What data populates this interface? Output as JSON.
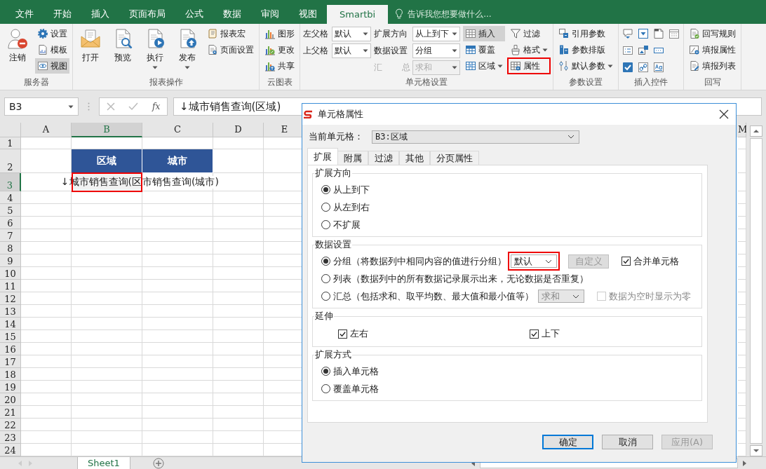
{
  "ribbon_tabs": [
    {
      "label": "文件",
      "selected": false
    },
    {
      "label": "开始",
      "selected": false
    },
    {
      "label": "插入",
      "selected": false
    },
    {
      "label": "页面布局",
      "selected": false
    },
    {
      "label": "公式",
      "selected": false
    },
    {
      "label": "数据",
      "selected": false
    },
    {
      "label": "审阅",
      "selected": false
    },
    {
      "label": "视图",
      "selected": false
    },
    {
      "label": "Smartbi",
      "selected": true
    }
  ],
  "tell_me": {
    "placeholder": "告诉我您想要做什么..."
  },
  "ribbon_groups": [
    {
      "label": "服务器",
      "columns": [
        [
          {
            "kind": "large",
            "label": "注销"
          }
        ],
        [
          {
            "kind": "small",
            "label": "设置"
          },
          {
            "kind": "small",
            "label": "模板"
          },
          {
            "kind": "small",
            "label": "视图",
            "pressed": true
          }
        ]
      ]
    },
    {
      "label": "报表操作",
      "columns": [
        [
          {
            "kind": "large",
            "label": "打开"
          }
        ],
        [
          {
            "kind": "large",
            "label": "预览"
          }
        ],
        [
          {
            "kind": "large",
            "label": "执行",
            "dropdown": true
          }
        ],
        [
          {
            "kind": "large",
            "label": "发布",
            "dropdown": true
          }
        ],
        [
          {
            "kind": "small",
            "label": "报表宏"
          },
          {
            "kind": "small",
            "label": "页面设置"
          }
        ]
      ]
    },
    {
      "label": "云图表",
      "columns": [
        [
          {
            "kind": "small",
            "label": "图形"
          },
          {
            "kind": "small",
            "label": "更改"
          },
          {
            "kind": "small",
            "label": "共享"
          }
        ]
      ]
    },
    {
      "label": "单元格设置",
      "columns": [
        [
          {
            "kind": "field",
            "label": "左父格",
            "value": "默认"
          },
          {
            "kind": "field",
            "label": "上父格",
            "value": "默认"
          }
        ],
        [
          {
            "kind": "field",
            "label": "扩展方向",
            "value": "从上到下"
          },
          {
            "kind": "field",
            "label": "数据设置",
            "value": "分组"
          },
          {
            "kind": "field",
            "label": "汇 总",
            "value": "求和",
            "disabled": true
          }
        ],
        [
          {
            "kind": "small",
            "label": "插入",
            "pressed": true
          },
          {
            "kind": "small",
            "label": "覆盖"
          },
          {
            "kind": "small",
            "label": "区域",
            "dropdown": true
          }
        ],
        [
          {
            "kind": "small",
            "label": "过滤"
          },
          {
            "kind": "small",
            "label": "格式",
            "dropdown": true
          },
          {
            "kind": "small",
            "label": "属性",
            "annotated": true
          }
        ]
      ]
    },
    {
      "label": "参数设置",
      "columns": [
        [
          {
            "kind": "small",
            "label": "引用参数"
          },
          {
            "kind": "small",
            "label": "参数排版"
          },
          {
            "kind": "small",
            "label": "默认参数",
            "dropdown": true
          }
        ]
      ]
    },
    {
      "label": "插入控件",
      "columns": [
        [
          {
            "kind": "icon"
          },
          {
            "kind": "icon"
          },
          {
            "kind": "icon"
          }
        ],
        [
          {
            "kind": "icon"
          },
          {
            "kind": "icon"
          },
          {
            "kind": "icon"
          }
        ],
        [
          {
            "kind": "icon"
          },
          {
            "kind": "icon"
          },
          {
            "kind": "icon"
          }
        ],
        [
          {
            "kind": "icon"
          }
        ]
      ]
    },
    {
      "label": "回写",
      "columns": [
        [
          {
            "kind": "small",
            "label": "回写规则"
          },
          {
            "kind": "small",
            "label": "填报属性"
          },
          {
            "kind": "small",
            "label": "填报列表"
          }
        ]
      ]
    }
  ],
  "formula_bar": {
    "name_box": "B3",
    "function_label": "fx",
    "formula": "↓城市销售查询(区域)"
  },
  "sheet": {
    "columns": [
      {
        "label": "A",
        "selected": false
      },
      {
        "label": "B",
        "selected": true
      },
      {
        "label": "C",
        "selected": false
      },
      {
        "label": "D",
        "selected": false
      },
      {
        "label": "E",
        "selected": false
      },
      {
        "label": "M",
        "selected": false
      }
    ],
    "rows": [
      {
        "label": "1",
        "selected": false
      },
      {
        "label": "2",
        "selected": false,
        "cells": {
          "B": {
            "text": "区域",
            "kind": "header"
          },
          "C": {
            "text": "城市",
            "kind": "header"
          }
        }
      },
      {
        "label": "3",
        "selected": true,
        "cells": {
          "B": {
            "text": "↓城市销售查询(区",
            "kind": "value",
            "selected": true,
            "annotated": true,
            "overflows_left": true
          },
          "C": {
            "text": "市销售查询(城市)",
            "kind": "value"
          }
        }
      },
      {
        "label": "4",
        "selected": false
      },
      {
        "label": "5",
        "selected": false
      },
      {
        "label": "6",
        "selected": false
      },
      {
        "label": "7",
        "selected": false
      },
      {
        "label": "8",
        "selected": false
      },
      {
        "label": "9",
        "selected": false
      },
      {
        "label": "10",
        "selected": false
      },
      {
        "label": "11",
        "selected": false
      },
      {
        "label": "12",
        "selected": false
      },
      {
        "label": "13",
        "selected": false
      },
      {
        "label": "14",
        "selected": false
      },
      {
        "label": "15",
        "selected": false
      },
      {
        "label": "16",
        "selected": false
      },
      {
        "label": "17",
        "selected": false
      },
      {
        "label": "18",
        "selected": false
      },
      {
        "label": "19",
        "selected": false
      },
      {
        "label": "20",
        "selected": false
      },
      {
        "label": "21",
        "selected": false
      },
      {
        "label": "22",
        "selected": false
      },
      {
        "label": "23",
        "selected": false
      },
      {
        "label": "24",
        "selected": false
      }
    ],
    "tabs": [
      {
        "label": "Sheet1",
        "selected": true
      }
    ]
  },
  "dialog": {
    "title": "单元格属性",
    "current_cell": {
      "label": "当前单元格：",
      "value": "B3:区域"
    },
    "tabs": [
      {
        "label": "扩展",
        "selected": true
      },
      {
        "label": "附属",
        "selected": false
      },
      {
        "label": "过滤",
        "selected": false
      },
      {
        "label": "其他",
        "selected": false
      },
      {
        "label": "分页属性",
        "selected": false
      }
    ],
    "sections": [
      {
        "title": "扩展方向",
        "kind": "radios",
        "options": [
          {
            "label": "从上到下",
            "selected": true
          },
          {
            "label": "从左到右",
            "selected": false
          },
          {
            "label": "不扩展",
            "selected": false
          }
        ]
      },
      {
        "title": "数据设置",
        "kind": "radios",
        "options": [
          {
            "label": "分组（将数据列中相同内容的值进行分组）",
            "selected": true,
            "select": {
              "value": "默认",
              "disabled": false,
              "annotated": true
            },
            "button": {
              "label": "自定义",
              "disabled": true
            },
            "checkbox": {
              "label": "合并单元格",
              "checked": true,
              "disabled": false
            }
          },
          {
            "label": "列表（数据列中的所有数据记录展示出来，无论数据是否重复）",
            "selected": false
          },
          {
            "label": "汇总（包括求和、取平均数、最大值和最小值等）",
            "selected": false,
            "select": {
              "value": "求和",
              "disabled": true
            },
            "checkbox": {
              "label": "数据为空时显示为零",
              "checked": false,
              "disabled": true
            }
          }
        ]
      },
      {
        "title": "延伸",
        "kind": "checks",
        "options": [
          {
            "label": "左右",
            "checked": true
          },
          {
            "label": "上下",
            "checked": true
          }
        ]
      },
      {
        "title": "扩展方式",
        "kind": "radios",
        "options": [
          {
            "label": "插入单元格",
            "selected": true
          },
          {
            "label": "覆盖单元格",
            "selected": false
          }
        ]
      }
    ],
    "buttons": [
      {
        "label": "确定",
        "default": true,
        "disabled": false
      },
      {
        "label": "取消",
        "default": false,
        "disabled": false
      },
      {
        "label": "应用(A)",
        "default": false,
        "disabled": true
      }
    ]
  }
}
